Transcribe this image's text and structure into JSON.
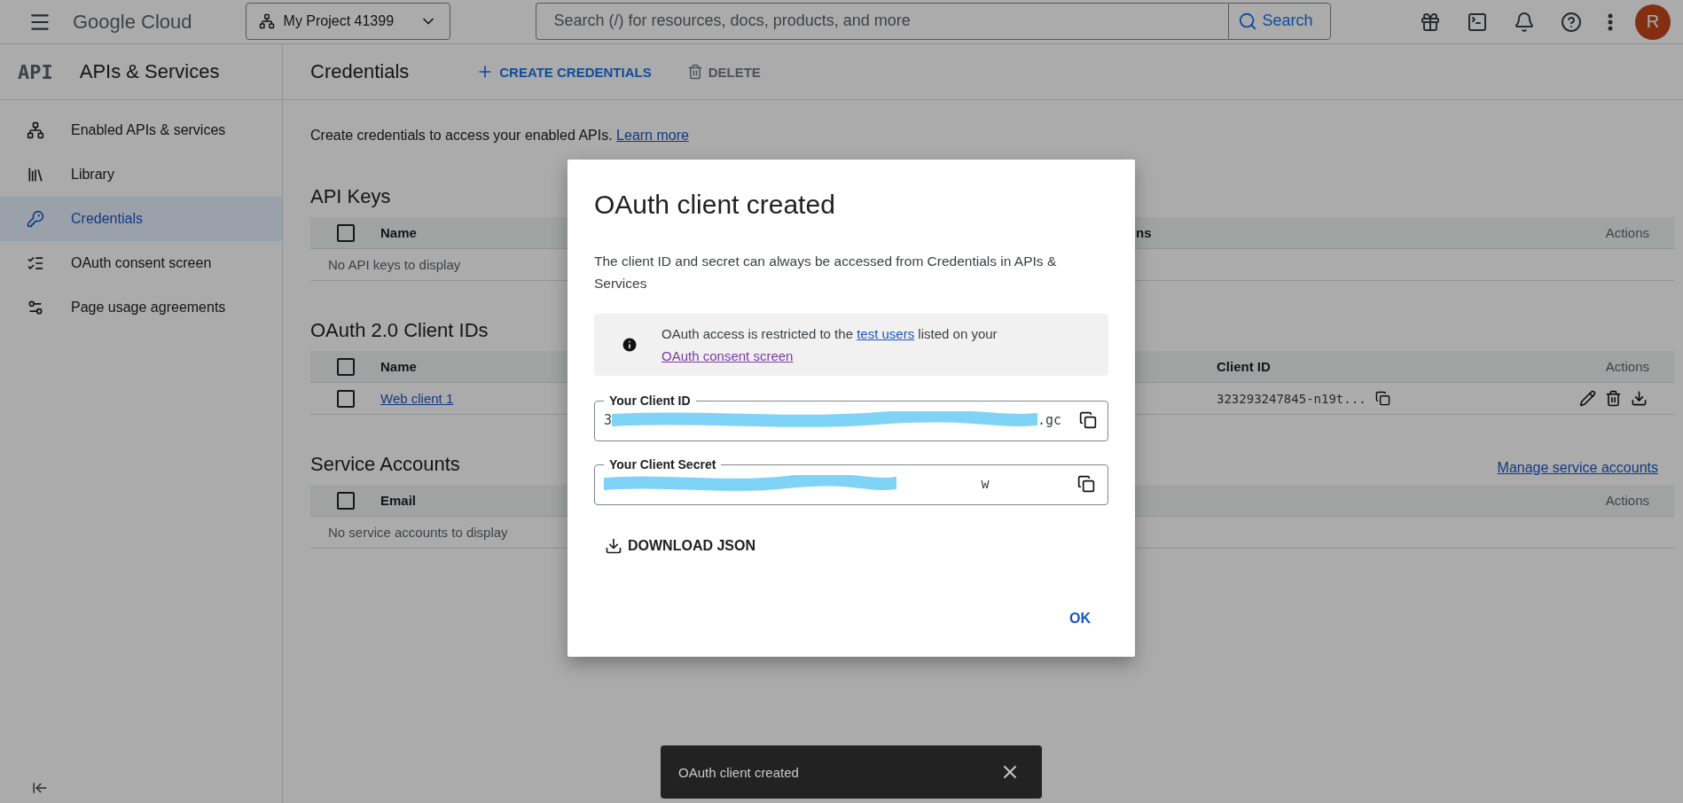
{
  "topbar": {
    "logo": "Google Cloud",
    "project": "My Project 41399",
    "search": {
      "placeholder": "Search (/) for resources, docs, products, and more"
    },
    "search_button": "Search",
    "avatar": "R"
  },
  "sidebar": {
    "badge": "API",
    "title": "APIs & Services",
    "items": [
      {
        "label": "Enabled APIs & services",
        "selected": false
      },
      {
        "label": "Library",
        "selected": false
      },
      {
        "label": "Credentials",
        "selected": true
      },
      {
        "label": "OAuth consent screen",
        "selected": false
      },
      {
        "label": "Page usage agreements",
        "selected": false
      }
    ]
  },
  "header": {
    "title": "Credentials",
    "actions": [
      {
        "kind": "create",
        "label": "CREATE CREDENTIALS",
        "disabled": false
      },
      {
        "kind": "delete",
        "label": "DELETE",
        "disabled": true
      }
    ]
  },
  "intro": {
    "text": "Create credentials to access your enabled APIs.",
    "link": "Learn more"
  },
  "sections": [
    {
      "kind": "api_keys",
      "title": "API Keys",
      "header_checked": false,
      "columns": [
        "Name",
        "ns",
        "Actions"
      ],
      "empty": "No API keys to display"
    },
    {
      "kind": "oauth",
      "title": "OAuth 2.0 Client IDs",
      "header_checked": false,
      "columns": [
        "Name",
        "Client ID",
        "Actions"
      ],
      "rows": [
        {
          "name": "Web client 1",
          "client_id": "323293247845-n19t...",
          "checked": false
        }
      ]
    },
    {
      "kind": "service",
      "title": "Service Accounts",
      "link": "Manage service accounts",
      "header_checked": false,
      "columns": [
        "Email",
        "Actions"
      ],
      "empty": "No service accounts to display"
    }
  ],
  "dialog": {
    "title": "OAuth client created",
    "description": "The client ID and secret can always be accessed from Credentials in APIs & Services",
    "notice": {
      "before": "OAuth access is restricted to the",
      "link1": "test users",
      "middle": "listed on your",
      "link2": "OAuth consent screen"
    },
    "fields": [
      {
        "label": "Your Client ID",
        "value_start": "3",
        "value_end": ".gc"
      },
      {
        "label": "Your Client Secret",
        "value_end": "w"
      }
    ],
    "download": "DOWNLOAD JSON",
    "ok": "OK"
  },
  "snackbar": {
    "message": "OAuth client created"
  }
}
